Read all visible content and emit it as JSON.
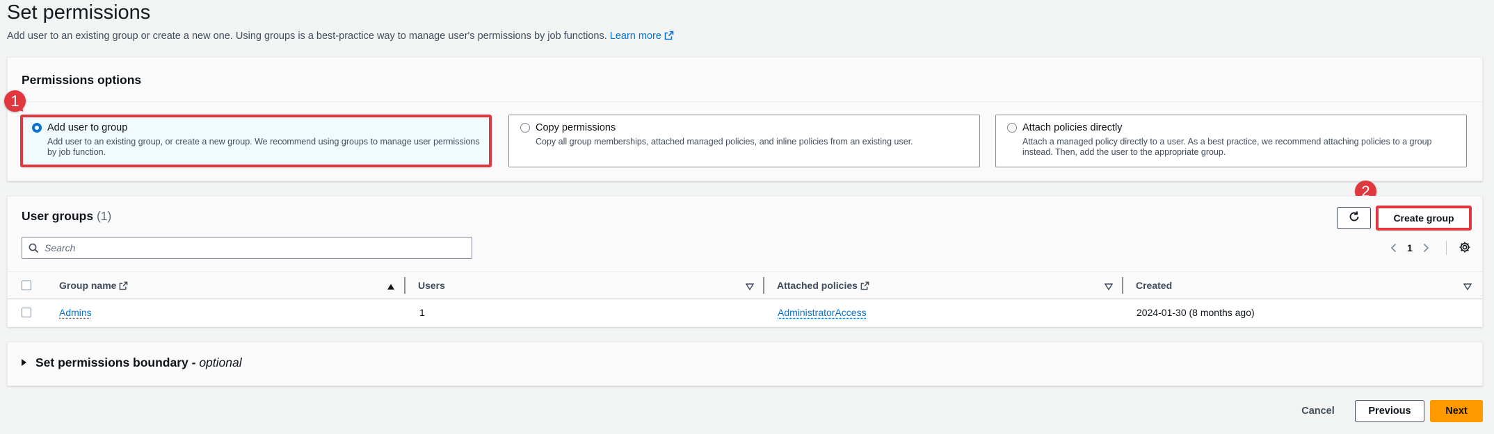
{
  "page": {
    "title": "Set permissions",
    "description": "Add user to an existing group or create a new one. Using groups is a best-practice way to manage user's permissions by job functions.",
    "learn_more": "Learn more"
  },
  "permissions_options": {
    "heading": "Permissions options",
    "options": [
      {
        "title": "Add user to group",
        "description": "Add user to an existing group, or create a new group. We recommend using groups to manage user permissions by job function.",
        "selected": true
      },
      {
        "title": "Copy permissions",
        "description": "Copy all group memberships, attached managed policies, and inline policies from an existing user.",
        "selected": false
      },
      {
        "title": "Attach policies directly",
        "description": "Attach a managed policy directly to a user. As a best practice, we recommend attaching policies to a group instead. Then, add the user to the appropriate group.",
        "selected": false
      }
    ]
  },
  "markers": {
    "one": "1",
    "two": "2"
  },
  "user_groups": {
    "heading": "User groups",
    "count": "(1)",
    "create_label": "Create group",
    "search_placeholder": "Search",
    "page_number": "1",
    "columns": {
      "group_name": "Group name",
      "users": "Users",
      "attached_policies": "Attached policies",
      "created": "Created"
    },
    "rows": [
      {
        "group_name": "Admins",
        "users": "1",
        "attached_policies": "AdministratorAccess",
        "created": "2024-01-30 (8 months ago)"
      }
    ]
  },
  "boundary": {
    "title": "Set permissions boundary - ",
    "optional": "optional"
  },
  "footer": {
    "cancel": "Cancel",
    "previous": "Previous",
    "next": "Next"
  },
  "colors": {
    "accent": "#0972d3",
    "highlight": "#e0383e",
    "primary_button": "#ff9900"
  }
}
